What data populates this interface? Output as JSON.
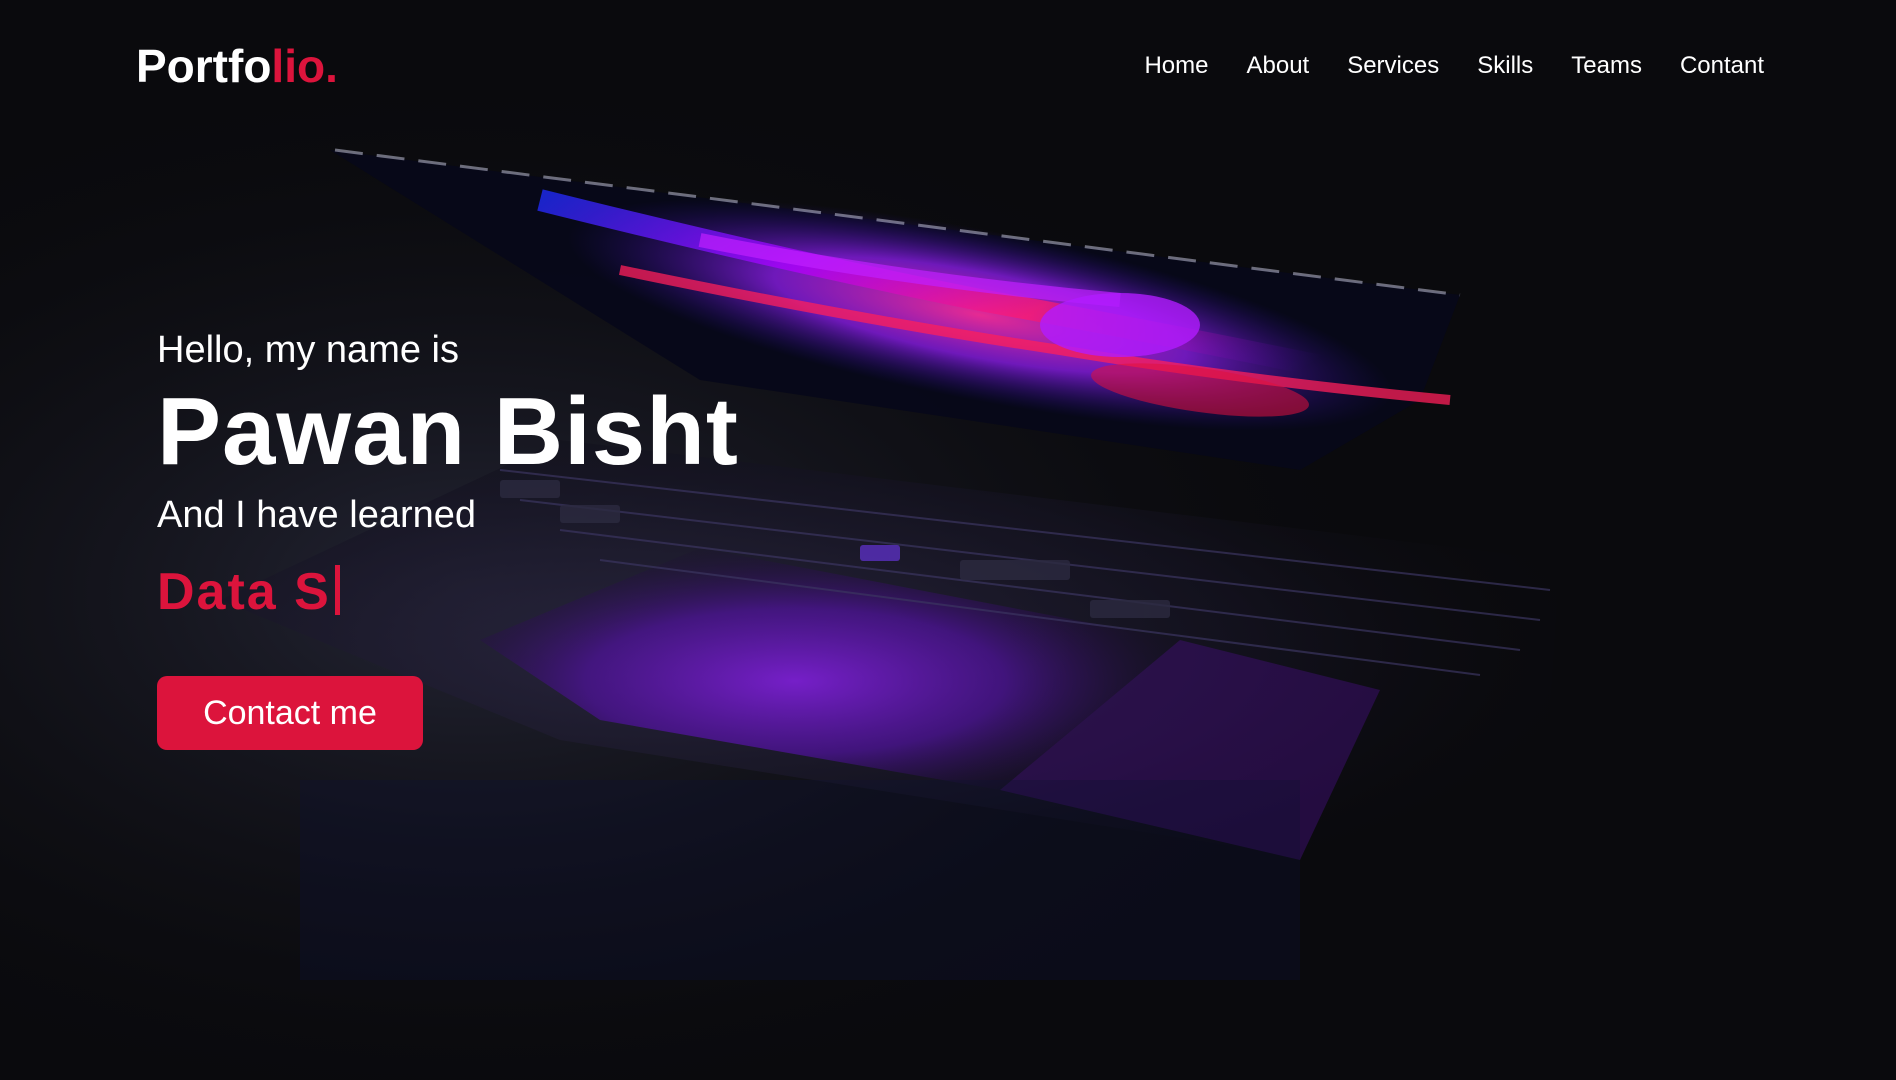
{
  "colors": {
    "accent": "#dc143c",
    "background": "#0a0a0d",
    "text": "#ffffff"
  },
  "logo": {
    "text_main": "Portfo",
    "text_accent": "lio."
  },
  "nav": {
    "items": [
      {
        "label": "Home"
      },
      {
        "label": "About"
      },
      {
        "label": "Services"
      },
      {
        "label": "Skills"
      },
      {
        "label": "Teams"
      },
      {
        "label": "Contant"
      }
    ]
  },
  "hero": {
    "greeting": "Hello, my name is",
    "name": "Pawan Bisht",
    "learned": "And I have learned",
    "typed_text": "Data S",
    "button_label": "Contact me"
  },
  "background": {
    "image": "laptop-keyboard-glow"
  }
}
